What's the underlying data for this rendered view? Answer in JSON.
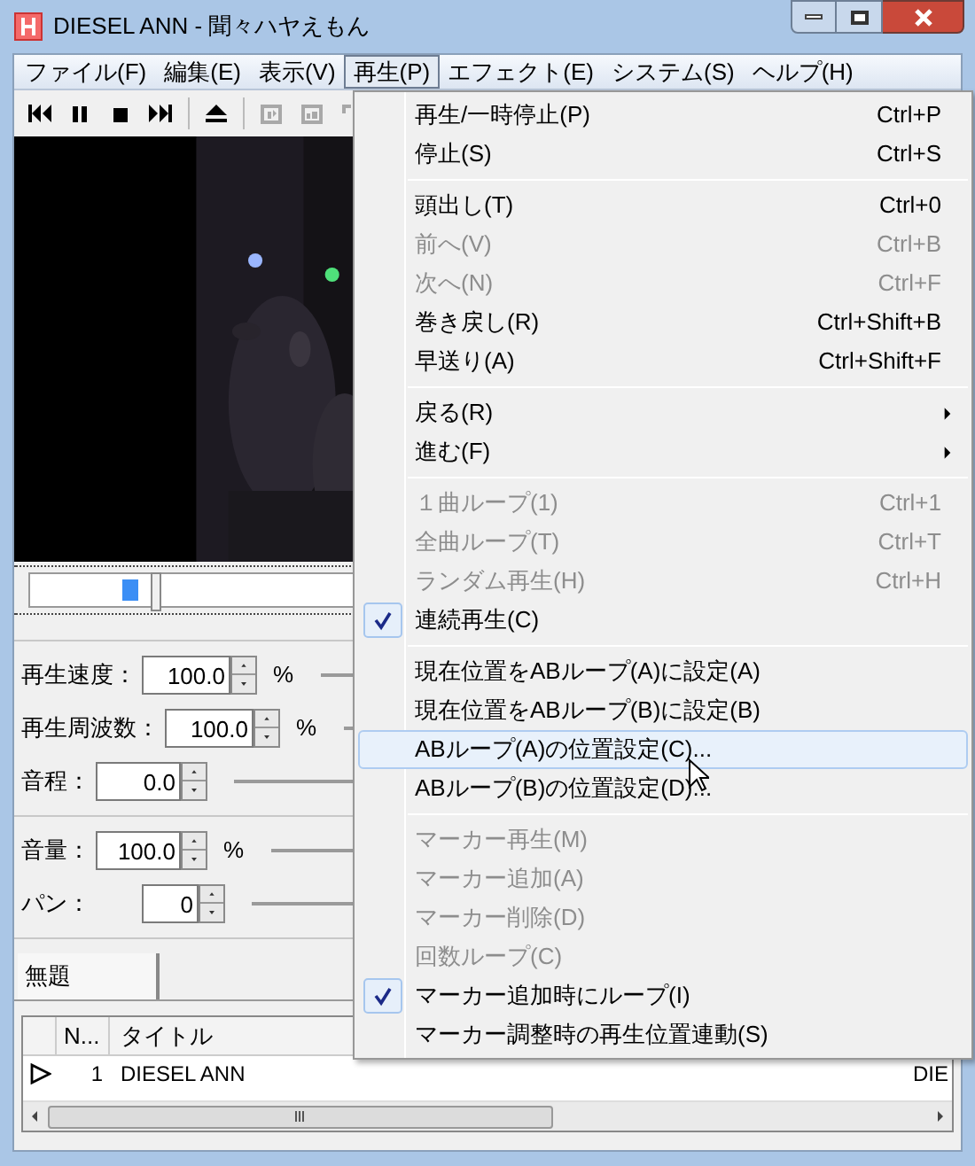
{
  "window": {
    "title": "DIESEL ANN - 聞々ハヤえもん"
  },
  "menubar": [
    {
      "label": "ファイル(F)",
      "selected": false
    },
    {
      "label": "編集(E)",
      "selected": false
    },
    {
      "label": "表示(V)",
      "selected": false
    },
    {
      "label": "再生(P)",
      "selected": true
    },
    {
      "label": "エフェクト(E)",
      "selected": false
    },
    {
      "label": "システム(S)",
      "selected": false
    },
    {
      "label": "ヘルプ(H)",
      "selected": false
    }
  ],
  "controls": [
    {
      "label": "再生速度：",
      "value": "100.0",
      "unit": "%"
    },
    {
      "label": "再生周波数：",
      "value": "100.0",
      "unit": "%"
    },
    {
      "label": "音程：",
      "value": "0.0"
    }
  ],
  "controls2": [
    {
      "label": "音量：",
      "value": "100.0",
      "unit": "%"
    },
    {
      "label": "パン：",
      "value": "0"
    }
  ],
  "tabs": [
    {
      "label": "無題",
      "selected": true
    }
  ],
  "playlist": {
    "columns": [
      "N...",
      "タイトル"
    ],
    "rows": [
      {
        "playing": true,
        "number": "1",
        "title": "DIESEL ANN",
        "column_3": "DIE"
      }
    ]
  },
  "menu": [
    {
      "kind": "item",
      "label": "再生/一時停止(P)",
      "shortcut": "Ctrl+P",
      "disabled": false,
      "checked": false,
      "selected": false
    },
    {
      "kind": "item",
      "label": "停止(S)",
      "shortcut": "Ctrl+S",
      "disabled": false,
      "checked": false,
      "selected": false
    },
    {
      "kind": "separator"
    },
    {
      "kind": "item",
      "label": "頭出し(T)",
      "shortcut": "Ctrl+0",
      "disabled": false,
      "checked": false,
      "selected": false
    },
    {
      "kind": "item",
      "label": "前へ(V)",
      "shortcut": "Ctrl+B",
      "disabled": true,
      "checked": false,
      "selected": false
    },
    {
      "kind": "item",
      "label": "次へ(N)",
      "shortcut": "Ctrl+F",
      "disabled": true,
      "checked": false,
      "selected": false
    },
    {
      "kind": "item",
      "label": "巻き戻し(R)",
      "shortcut": "Ctrl+Shift+B",
      "disabled": false,
      "checked": false,
      "selected": false
    },
    {
      "kind": "item",
      "label": "早送り(A)",
      "shortcut": "Ctrl+Shift+F",
      "disabled": false,
      "checked": false,
      "selected": false
    },
    {
      "kind": "separator"
    },
    {
      "kind": "submenu",
      "label": "戻る(R)",
      "disabled": false,
      "checked": false,
      "selected": false
    },
    {
      "kind": "submenu",
      "label": "進む(F)",
      "disabled": false,
      "checked": false,
      "selected": false
    },
    {
      "kind": "separator"
    },
    {
      "kind": "item",
      "label": "１曲ループ(1)",
      "shortcut": "Ctrl+1",
      "disabled": true,
      "checked": false,
      "selected": false
    },
    {
      "kind": "item",
      "label": "全曲ループ(T)",
      "shortcut": "Ctrl+T",
      "disabled": true,
      "checked": false,
      "selected": false
    },
    {
      "kind": "item",
      "label": "ランダム再生(H)",
      "shortcut": "Ctrl+H",
      "disabled": true,
      "checked": false,
      "selected": false
    },
    {
      "kind": "item",
      "label": "連続再生(C)",
      "disabled": false,
      "checked": true,
      "selected": false
    },
    {
      "kind": "separator"
    },
    {
      "kind": "item",
      "label": "現在位置をABループ(A)に設定(A)",
      "disabled": false,
      "checked": false,
      "selected": false
    },
    {
      "kind": "item",
      "label": "現在位置をABループ(B)に設定(B)",
      "disabled": false,
      "checked": false,
      "selected": false
    },
    {
      "kind": "item",
      "label": "ABループ(A)の位置設定(C)...",
      "disabled": false,
      "checked": false,
      "selected": true
    },
    {
      "kind": "item",
      "label": "ABループ(B)の位置設定(D)...",
      "disabled": false,
      "checked": false,
      "selected": false
    },
    {
      "kind": "separator"
    },
    {
      "kind": "item",
      "label": "マーカー再生(M)",
      "disabled": true,
      "checked": false,
      "selected": false
    },
    {
      "kind": "item",
      "label": "マーカー追加(A)",
      "disabled": true,
      "checked": false,
      "selected": false
    },
    {
      "kind": "item",
      "label": "マーカー削除(D)",
      "disabled": true,
      "checked": false,
      "selected": false
    },
    {
      "kind": "item",
      "label": "回数ループ(C)",
      "disabled": true,
      "checked": false,
      "selected": false
    },
    {
      "kind": "item",
      "label": "マーカー追加時にループ(I)",
      "disabled": false,
      "checked": true,
      "selected": false
    },
    {
      "kind": "item",
      "label": "マーカー調整時の再生位置連動(S)",
      "disabled": false,
      "checked": false,
      "selected": false
    }
  ]
}
